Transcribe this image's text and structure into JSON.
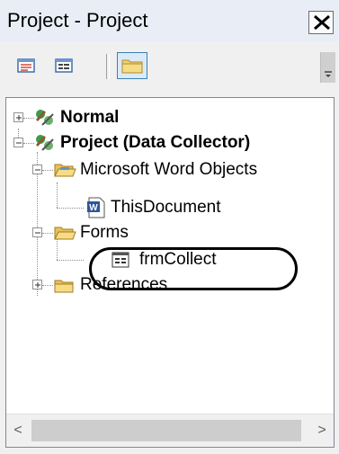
{
  "window": {
    "title": "Project - Project",
    "close_glyph": "X"
  },
  "toolbar": {
    "buttons": [
      {
        "icon": "view-code-icon",
        "active": false
      },
      {
        "icon": "view-object-icon",
        "active": false
      },
      {
        "icon": "toggle-folders-icon",
        "active": true
      }
    ]
  },
  "tree": {
    "nodes": [
      {
        "label": "Normal",
        "bold": true,
        "expander": "+",
        "icon": "vba-project-icon"
      },
      {
        "label": "Project (Data Collector)",
        "bold": true,
        "expander": "-",
        "icon": "vba-project-icon"
      },
      {
        "label": "Microsoft Word Objects",
        "bold": false,
        "expander": "-",
        "icon": "folder-open-icon"
      },
      {
        "label": "ThisDocument",
        "bold": false,
        "expander": "",
        "icon": "word-document-icon"
      },
      {
        "label": "Forms",
        "bold": false,
        "expander": "-",
        "icon": "folder-open-icon"
      },
      {
        "label": "frmCollect",
        "bold": false,
        "expander": "",
        "icon": "userform-icon"
      },
      {
        "label": "References",
        "bold": false,
        "expander": "+",
        "icon": "folder-closed-icon"
      }
    ]
  },
  "scrollbar": {
    "left_arrow": "<",
    "right_arrow": ">"
  },
  "colors": {
    "accent": "#3c7fb1",
    "folder": "#f0d071",
    "word_blue": "#2b579a"
  }
}
